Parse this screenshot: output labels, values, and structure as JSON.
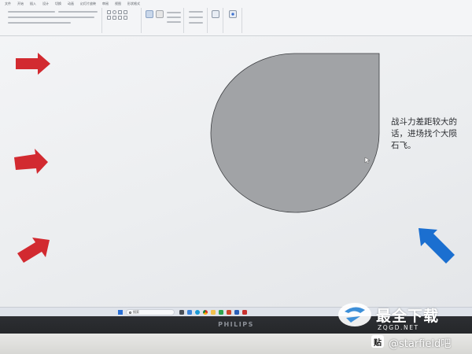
{
  "ribbon": {
    "tabs": [
      "文件",
      "开始",
      "插入",
      "设计",
      "切换",
      "动画",
      "幻灯片放映",
      "审阅",
      "视图",
      "形状格式"
    ]
  },
  "slide": {
    "annotation": "战斗力差距较大的话，进场找个大陨石飞。",
    "shape_fill": "#a1a3a6",
    "arrow_color": "#d22a30",
    "arrow_color_blue": "#1b6fd0"
  },
  "taskbar": {
    "search_label": "搜索"
  },
  "monitor": {
    "brand": "PHILIPS"
  },
  "watermark": {
    "title": "最全下载",
    "url": "ZQGD.NET",
    "tieba_badge": "贴",
    "tieba_user": "@starfield吧"
  }
}
